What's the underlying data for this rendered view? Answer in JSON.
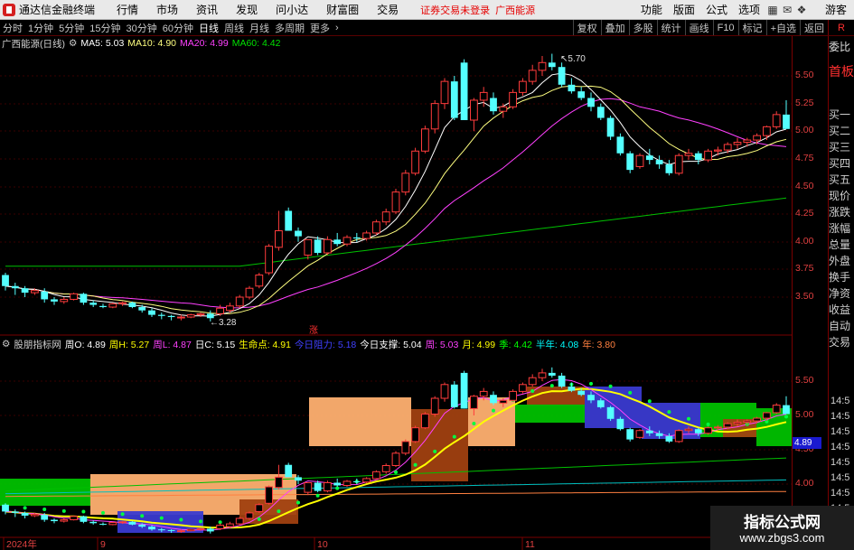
{
  "menubar": {
    "app_title": "通达信金融终端",
    "items": [
      "行情",
      "市场",
      "资讯",
      "发现",
      "问小达",
      "财富圈",
      "交易"
    ],
    "notice": "证券交易未登录",
    "stock": "广西能源",
    "right_items": [
      "功能",
      "版面",
      "公式",
      "选项"
    ],
    "guest": "游客"
  },
  "periods": {
    "items": [
      "分时",
      "1分钟",
      "5分钟",
      "15分钟",
      "30分钟",
      "60分钟",
      "日线",
      "周线",
      "月线",
      "多周期",
      "更多"
    ],
    "active": "日线",
    "tools": [
      "复权",
      "叠加",
      "多股",
      "统计",
      "画线",
      "F10",
      "标记",
      "+自选",
      "返回"
    ],
    "r_label": "R"
  },
  "main_legend": {
    "title": "广西能源(日线)",
    "ma5": "MA5: 5.03",
    "ma10": "MA10: 4.90",
    "ma20": "MA20: 4.99",
    "ma60": "MA60: 4.42"
  },
  "sub_legend": {
    "name": "股朋指标网",
    "items": [
      {
        "text": "周O: 4.89",
        "color": "#ffffff"
      },
      {
        "text": "周H: 5.27",
        "color": "#ffff00"
      },
      {
        "text": "周L: 4.87",
        "color": "#ff40ff"
      },
      {
        "text": "日C: 5.15",
        "color": "#ffffff"
      },
      {
        "text": "生命点: 4.91",
        "color": "#ffff00"
      },
      {
        "text": "今日阻力: 5.18",
        "color": "#4040ff"
      },
      {
        "text": "今日支撑: 5.04",
        "color": "#ffffff"
      },
      {
        "text": "周: 5.03",
        "color": "#ff40ff"
      },
      {
        "text": "月: 4.99",
        "color": "#ffff00"
      },
      {
        "text": "季: 4.42",
        "color": "#00ff00"
      },
      {
        "text": "半年: 4.08",
        "color": "#00ffff"
      },
      {
        "text": "年: 3.80",
        "color": "#ff8040"
      }
    ]
  },
  "annotations": {
    "high": "5.70",
    "low": "3.28",
    "zhang": "涨",
    "price_tag": "4.89"
  },
  "main_axis": [
    "5.50",
    "5.25",
    "5.00",
    "4.75",
    "4.50",
    "4.25",
    "4.00",
    "3.75",
    "3.50"
  ],
  "sub_axis": [
    "5.50",
    "5.00",
    "4.50",
    "4.00"
  ],
  "dates": [
    "2024年",
    "9",
    "10",
    "11"
  ],
  "sidebar": {
    "top": "委比",
    "items": [
      "首板",
      "买一",
      "买二",
      "买三",
      "买四",
      "买五",
      "现价",
      "涨跌",
      "涨幅",
      "总量",
      "外盘",
      "换手",
      "净资",
      "收益",
      "自动",
      "交易"
    ],
    "times": [
      "14:5",
      "14:5",
      "14:5",
      "14:5",
      "14:5",
      "14:5",
      "14:5",
      "14:5",
      "14:5",
      "14:5"
    ]
  },
  "watermark": {
    "line1": "指标公式网",
    "line2": "www.zbgs3.com"
  },
  "colors": {
    "up": "#ff3c3c",
    "down": "#54ffff",
    "ma5": "#ffffff",
    "ma10": "#ffff80",
    "ma20": "#ff40ff",
    "ma60": "#00c000"
  },
  "chart_data": {
    "type": "candlestick",
    "dates": [
      "2024年",
      "9",
      "10",
      "11"
    ],
    "ohlc": [
      [
        3.7,
        3.72,
        3.56,
        3.6
      ],
      [
        3.6,
        3.63,
        3.52,
        3.58
      ],
      [
        3.58,
        3.6,
        3.5,
        3.54
      ],
      [
        3.54,
        3.58,
        3.52,
        3.56
      ],
      [
        3.55,
        3.58,
        3.45,
        3.48
      ],
      [
        3.48,
        3.5,
        3.43,
        3.46
      ],
      [
        3.46,
        3.5,
        3.44,
        3.48
      ],
      [
        3.48,
        3.54,
        3.47,
        3.53
      ],
      [
        3.53,
        3.54,
        3.43,
        3.45
      ],
      [
        3.45,
        3.47,
        3.41,
        3.43
      ],
      [
        3.42,
        3.44,
        3.4,
        3.41
      ],
      [
        3.41,
        3.45,
        3.4,
        3.44
      ],
      [
        3.44,
        3.46,
        3.42,
        3.45
      ],
      [
        3.45,
        3.46,
        3.4,
        3.41
      ],
      [
        3.41,
        3.43,
        3.36,
        3.38
      ],
      [
        3.38,
        3.4,
        3.32,
        3.34
      ],
      [
        3.34,
        3.36,
        3.3,
        3.33
      ],
      [
        3.33,
        3.34,
        3.29,
        3.32
      ],
      [
        3.32,
        3.34,
        3.29,
        3.32
      ],
      [
        3.32,
        3.35,
        3.31,
        3.34
      ],
      [
        3.34,
        3.36,
        3.32,
        3.35
      ],
      [
        3.35,
        3.38,
        3.28,
        3.31
      ],
      [
        3.35,
        3.43,
        3.33,
        3.4
      ],
      [
        3.38,
        3.45,
        3.36,
        3.42
      ],
      [
        3.42,
        3.52,
        3.4,
        3.5
      ],
      [
        3.5,
        3.6,
        3.48,
        3.58
      ],
      [
        3.6,
        3.72,
        3.58,
        3.7
      ],
      [
        3.72,
        3.98,
        3.7,
        3.96
      ],
      [
        3.95,
        4.28,
        3.92,
        4.1
      ],
      [
        4.28,
        4.31,
        4.1,
        4.1
      ],
      [
        4.1,
        4.13,
        4.0,
        4.05
      ],
      [
        3.88,
        3.98,
        3.84,
        4.02
      ],
      [
        4.02,
        4.05,
        3.88,
        3.9
      ],
      [
        3.9,
        4.05,
        3.88,
        4.02
      ],
      [
        4.02,
        4.08,
        3.96,
        3.98
      ],
      [
        3.98,
        4.06,
        3.96,
        4.04
      ],
      [
        4.04,
        4.08,
        4.0,
        4.03
      ],
      [
        4.03,
        4.1,
        4.01,
        4.08
      ],
      [
        4.08,
        4.2,
        4.06,
        4.18
      ],
      [
        4.18,
        4.3,
        4.15,
        4.27
      ],
      [
        4.27,
        4.48,
        4.25,
        4.45
      ],
      [
        4.45,
        4.65,
        4.42,
        4.62
      ],
      [
        4.62,
        4.85,
        4.6,
        4.82
      ],
      [
        4.82,
        5.05,
        4.8,
        5.02
      ],
      [
        5.02,
        5.28,
        4.98,
        5.25
      ],
      [
        5.25,
        5.48,
        5.2,
        5.45
      ],
      [
        5.45,
        5.5,
        5.1,
        5.12
      ],
      [
        5.62,
        5.65,
        5.1,
        5.1
      ],
      [
        5.1,
        5.3,
        5.0,
        5.28
      ],
      [
        5.28,
        5.4,
        5.22,
        5.35
      ],
      [
        5.3,
        5.35,
        5.15,
        5.18
      ],
      [
        5.18,
        5.25,
        5.12,
        5.22
      ],
      [
        5.22,
        5.38,
        5.2,
        5.35
      ],
      [
        5.35,
        5.48,
        5.32,
        5.45
      ],
      [
        5.45,
        5.6,
        5.42,
        5.55
      ],
      [
        5.55,
        5.68,
        5.5,
        5.62
      ],
      [
        5.62,
        5.7,
        5.55,
        5.58
      ],
      [
        5.58,
        5.62,
        5.4,
        5.42
      ],
      [
        5.42,
        5.48,
        5.34,
        5.36
      ],
      [
        5.36,
        5.4,
        5.28,
        5.3
      ],
      [
        5.3,
        5.35,
        5.18,
        5.22
      ],
      [
        5.22,
        5.25,
        5.1,
        5.12
      ],
      [
        5.12,
        5.14,
        4.92,
        4.95
      ],
      [
        4.95,
        4.98,
        4.78,
        4.8
      ],
      [
        4.8,
        4.82,
        4.62,
        4.65
      ],
      [
        4.68,
        4.8,
        4.66,
        4.78
      ],
      [
        4.78,
        4.84,
        4.7,
        4.74
      ],
      [
        4.74,
        4.78,
        4.66,
        4.7
      ],
      [
        4.7,
        4.74,
        4.6,
        4.62
      ],
      [
        4.62,
        4.8,
        4.6,
        4.78
      ],
      [
        4.78,
        4.84,
        4.74,
        4.8
      ],
      [
        4.8,
        4.82,
        4.7,
        4.74
      ],
      [
        4.74,
        4.84,
        4.72,
        4.82
      ],
      [
        4.82,
        4.86,
        4.78,
        4.83
      ],
      [
        4.83,
        4.9,
        4.8,
        4.88
      ],
      [
        4.88,
        4.94,
        4.84,
        4.9
      ],
      [
        4.9,
        4.94,
        4.86,
        4.92
      ],
      [
        4.92,
        4.98,
        4.88,
        4.96
      ],
      [
        4.96,
        5.05,
        4.92,
        5.04
      ],
      [
        5.04,
        5.18,
        5.02,
        5.15
      ],
      [
        5.15,
        5.28,
        5.1,
        5.02
      ]
    ],
    "main_ylim": [
      3.28,
      5.7
    ],
    "ma": {
      "MA5": 5.03,
      "MA10": 4.9,
      "MA20": 4.99,
      "MA60": 4.42
    }
  }
}
